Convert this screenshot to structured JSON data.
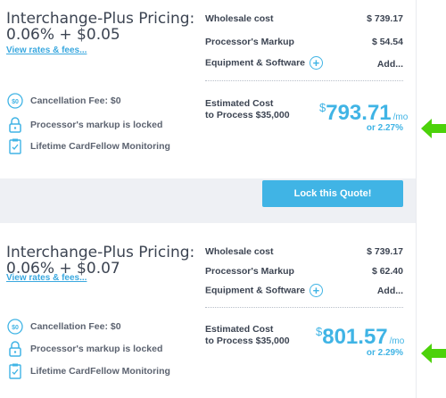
{
  "quotes": [
    {
      "title_line1": "Interchange-Plus Pricing:",
      "title_line2": "0.06% + $0.05",
      "view_link": "View rates & fees...",
      "wholesale_label": "Wholesale cost",
      "wholesale_value": "$ 739.17",
      "markup_label": "Processor's Markup",
      "markup_value": "$ 54.54",
      "equipment_label": "Equipment & Software",
      "equipment_value": "Add...",
      "features": [
        "Cancellation Fee: $0",
        "Processor's markup is locked",
        "Lifetime CardFellow Monitoring"
      ],
      "estimated_line1": "Estimated Cost",
      "estimated_line2_prefix": "to Process ",
      "estimated_amount_processed": "$35,000",
      "currency": "$",
      "estimated_cost": "793.71",
      "per": "/mo",
      "rate": "or 2.27%"
    },
    {
      "title_line1": "Interchange-Plus Pricing:",
      "title_line2": "0.06% + $0.07",
      "view_link": "View rates & fees...",
      "wholesale_label": "Wholesale cost",
      "wholesale_value": "$ 739.17",
      "markup_label": "Processor's Markup",
      "markup_value": "$ 62.40",
      "equipment_label": "Equipment & Software",
      "equipment_value": "Add...",
      "features": [
        "Cancellation Fee: $0",
        "Processor's markup is locked",
        "Lifetime CardFellow Monitoring"
      ],
      "estimated_line1": "Estimated Cost",
      "estimated_line2_prefix": "to Process ",
      "estimated_amount_processed": "$35,000",
      "currency": "$",
      "estimated_cost": "801.57",
      "per": "/mo",
      "rate": "or 2.29%"
    }
  ],
  "lock_button": "Lock this Quote!",
  "icons": {
    "fee": "zero-dollar-icon",
    "lock": "padlock-icon",
    "monitor": "clipboard-check-icon",
    "add": "plus-circle-icon",
    "pointer": "green-arrow-icon"
  },
  "colors": {
    "accent": "#40b4e5",
    "arrow": "#4cd20a",
    "text": "#3c4452"
  }
}
